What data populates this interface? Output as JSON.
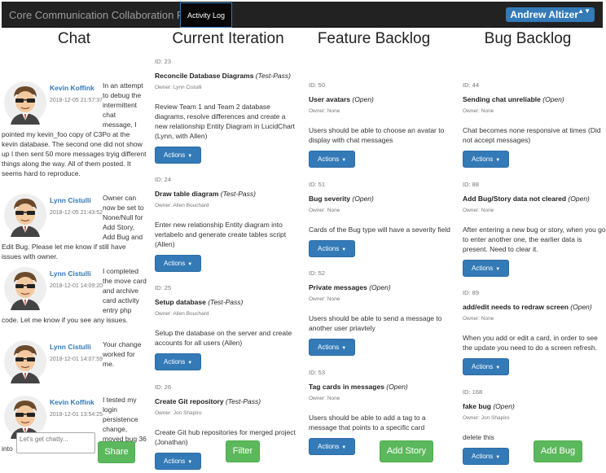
{
  "navbar": {
    "brand": "Core Communication Collaboration Portal",
    "active_tab": "Activity Log",
    "user": "Andrew Altizer",
    "user_caret": "▲▼"
  },
  "columns": {
    "chat": "Chat",
    "iteration": "Current Iteration",
    "feature": "Feature Backlog",
    "bug": "Bug Backlog"
  },
  "chat": {
    "messages": [
      {
        "author": "Kevin Koffink",
        "time": "2018-12-05 21:57:37",
        "text": "In an attempt to debug the intermittent chat message, I pointed my kevin_foo copy of C3Po at the kevin database. The second one did not show up I then sent 50 more messages tryig different things along the way. All of them posted. It seems hard to reproduce."
      },
      {
        "author": "Lynn Cistulli",
        "time": "2018-12-05 21:43:52",
        "text": "Owner can now be set to None/Null for Add Story, Add Bug and Edit Bug. Please let me know if still have issues with owner."
      },
      {
        "author": "Lynn Cistulli",
        "time": "2018-12-01 14:09:20",
        "text": "I completed the move card and archive card activity entry php code. Let me know if you see any issues."
      },
      {
        "author": "Lynn Cistulli",
        "time": "2018-12-01 14:07:59",
        "text": "Your change worked for me."
      },
      {
        "author": "Kevin Koffink",
        "time": "2018-12-01 13:54:25",
        "text": "I tested my login persistence change, moved bug 36 into"
      }
    ],
    "input_placeholder": "Let's get chatty...",
    "share_label": "Share"
  },
  "iteration": {
    "cards": [
      {
        "id": "ID: 23",
        "title": "Reconcile Database Diagrams",
        "status": "(Test-Pass)",
        "owner": "Owner: Lynn Cistulli",
        "desc": "Review Team 1 and Team 2 database diagrams, resolve differences and create a new relationship Entity Diagram in LucidChart (Lynn, with Allen)",
        "actions": "Actions"
      },
      {
        "id": "ID: 24",
        "title": "Draw table diagram",
        "status": "(Test-Pass)",
        "owner": "Owner: Allen Bouchard",
        "desc": "Enter new relationship Entity diagram into vertabelo and generate create tables script (Allen)",
        "actions": "Actions"
      },
      {
        "id": "ID: 25",
        "title": "Setup database",
        "status": "(Test-Pass)",
        "owner": "Owner: Allen Bouchard",
        "desc": "Setup the database on the server and create accounts for all users (Allen)",
        "actions": "Actions"
      },
      {
        "id": "ID: 26",
        "title": "Create Git repository",
        "status": "(Test-Pass)",
        "owner": "Owner: Jon Shapiro",
        "desc": "Create Git hub repositories for merged project (Jonathan)",
        "actions": "Actions"
      }
    ],
    "filter_label": "Filter"
  },
  "feature": {
    "cards": [
      {
        "id": "ID: 50",
        "title": "User avatars",
        "status": "(Open)",
        "owner": "Owner: None",
        "desc": "Users should be able to choose an avatar to display with chat messages",
        "actions": "Actions"
      },
      {
        "id": "ID: 51",
        "title": "Bug severity",
        "status": "(Open)",
        "owner": "Owner: None",
        "desc": "Cards of the Bug type will have a severity field",
        "actions": "Actions"
      },
      {
        "id": "ID: 52",
        "title": "Private messages",
        "status": "(Open)",
        "owner": "Owner: None",
        "desc": "Users should be able to send a message to another user priavtely",
        "actions": "Actions"
      },
      {
        "id": "ID: 53",
        "title": "Tag cards in messages",
        "status": "(Open)",
        "owner": "Owner: None",
        "desc": "Users should be able to add a tag to a message that points to a specific card",
        "actions": "Actions"
      }
    ],
    "add_label": "Add Story"
  },
  "bug": {
    "cards": [
      {
        "id": "ID: 44",
        "title": "Sending chat unreliable",
        "status": "(Open)",
        "owner": "Owner: None",
        "desc": "Chat becomes none responsive at times (Did not accept messages)",
        "actions": "Actions"
      },
      {
        "id": "ID: 88",
        "title": "Add Bug/Story data not cleared",
        "status": "(Open)",
        "owner": "Owner: None",
        "desc": "After entering a new bug or story, when you go to enter another one, the earlier data is present. Need to clear it.",
        "actions": "Actions"
      },
      {
        "id": "ID: 89",
        "title": "add/edit needs to redraw screen",
        "status": "(Open)",
        "owner": "Owner: None",
        "desc": "When you add or edit a card, in order to see the update you need to do a screen refresh.",
        "actions": "Actions"
      },
      {
        "id": "ID: 168",
        "title": "fake bug",
        "status": "(Open)",
        "owner": "Owner: Jon Shapiro",
        "desc": "delete this",
        "actions": "Actions"
      }
    ],
    "add_label": "Add Bug"
  },
  "colors": {
    "primary": "#337ab7",
    "success": "#5cb85c",
    "navbar": "#222222"
  }
}
